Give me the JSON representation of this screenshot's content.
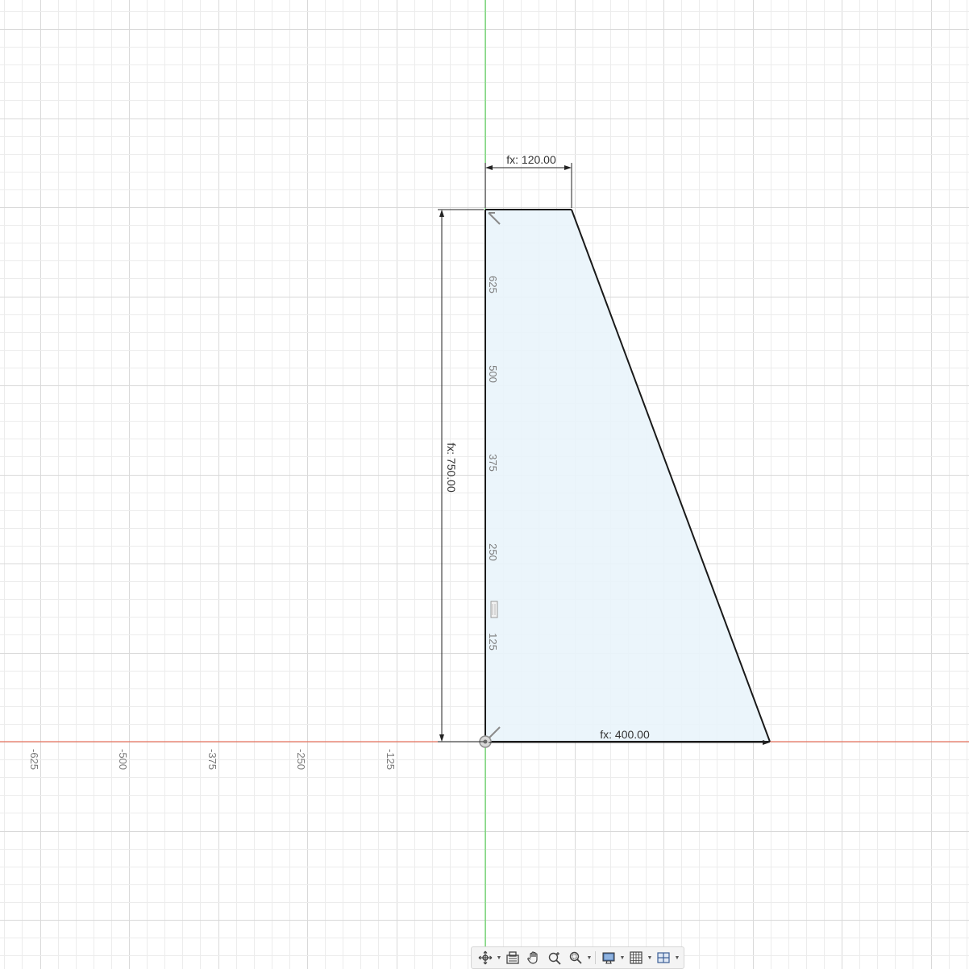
{
  "sketch": {
    "dimensions": {
      "top_width": "fx: 120.00",
      "height": "fx: 750.00",
      "base_width": "fx: 400.00"
    },
    "y_axis_labels": [
      "125",
      "250",
      "375",
      "500",
      "625"
    ],
    "x_axis_labels": [
      "-125",
      "-250",
      "-375",
      "-500",
      "-625"
    ],
    "colors": {
      "x_axis": "#e8553c",
      "y_axis": "#3ccf3c",
      "profile_fill": "#e9f4fb",
      "profile_edge": "#1a1a1a",
      "grid_minor": "#ececec",
      "grid_major": "#d9d9d9"
    }
  },
  "toolbar": {
    "items": [
      {
        "icon": "orbit-icon",
        "caret": true
      },
      {
        "icon": "look-at-icon",
        "caret": false
      },
      {
        "icon": "pan-hand-icon",
        "caret": false
      },
      {
        "icon": "zoom-icon",
        "caret": false
      },
      {
        "icon": "zoom-window-icon",
        "caret": true
      },
      {
        "icon": "display-settings-icon",
        "caret": true
      },
      {
        "icon": "grid-snap-icon",
        "caret": true
      },
      {
        "icon": "viewports-icon",
        "caret": true
      }
    ]
  }
}
